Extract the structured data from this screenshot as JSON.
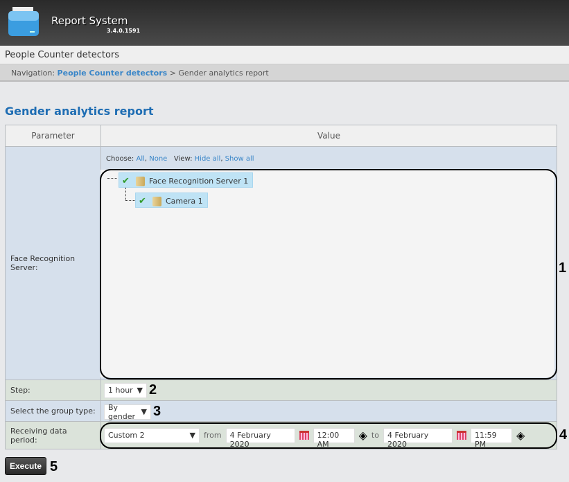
{
  "header": {
    "app_title": "Report System",
    "version": "3.4.0.1591"
  },
  "section_title": "People Counter detectors",
  "breadcrumb": {
    "prefix": "Navigation:",
    "link": "People Counter detectors",
    "separator": ">",
    "current": "Gender analytics report"
  },
  "page_title": "Gender analytics report",
  "table": {
    "col_parameter": "Parameter",
    "col_value": "Value"
  },
  "server_row": {
    "label": "Face Recognition Server:",
    "choose": "Choose:",
    "all": "All",
    "none": "None",
    "view": "View:",
    "hide_all": "Hide all",
    "show_all": "Show all",
    "tree": [
      {
        "label": "Face Recognition Server 1",
        "checked": true
      },
      {
        "label": "Camera 1",
        "checked": true
      }
    ]
  },
  "step_row": {
    "label": "Step:",
    "value": "1 hour"
  },
  "group_row": {
    "label": "Select the group type:",
    "value": "By gender"
  },
  "period_row": {
    "label": "Receiving data period:",
    "preset": "Custom 2",
    "from": "from",
    "from_date": "4 February 2020",
    "from_time": "12:00 AM",
    "to": "to",
    "to_date": "4 February 2020",
    "to_time": "11:59 PM"
  },
  "execute_label": "Execute",
  "callouts": [
    "1",
    "2",
    "3",
    "4",
    "5"
  ]
}
